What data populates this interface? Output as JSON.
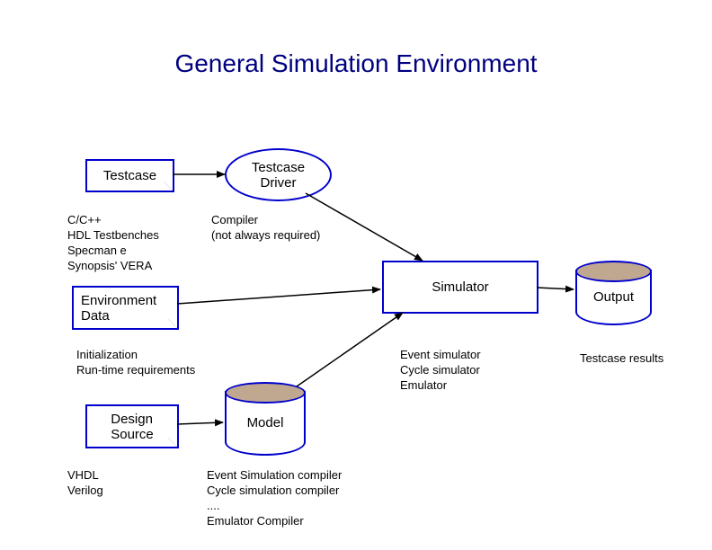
{
  "title": "General Simulation Environment",
  "nodes": {
    "testcase": "Testcase",
    "testcase_driver": "Testcase\nDriver",
    "environment_data": "Environment\nData",
    "simulator": "Simulator",
    "output": "Output",
    "design_source": "Design\nSource",
    "model": "Model"
  },
  "labels": {
    "testcase_langs": "C/C++\nHDL Testbenches\nSpecman e\nSynopsis' VERA",
    "compiler": "Compiler\n(not always required)",
    "env_data_desc": "Initialization\nRun-time requirements",
    "simulator_types": "Event simulator\nCycle simulator\nEmulator",
    "output_desc": "Testcase results",
    "design_source_langs": "VHDL\nVerilog",
    "model_compilers": "Event Simulation compiler\nCycle simulation compiler\n....\nEmulator Compiler"
  }
}
